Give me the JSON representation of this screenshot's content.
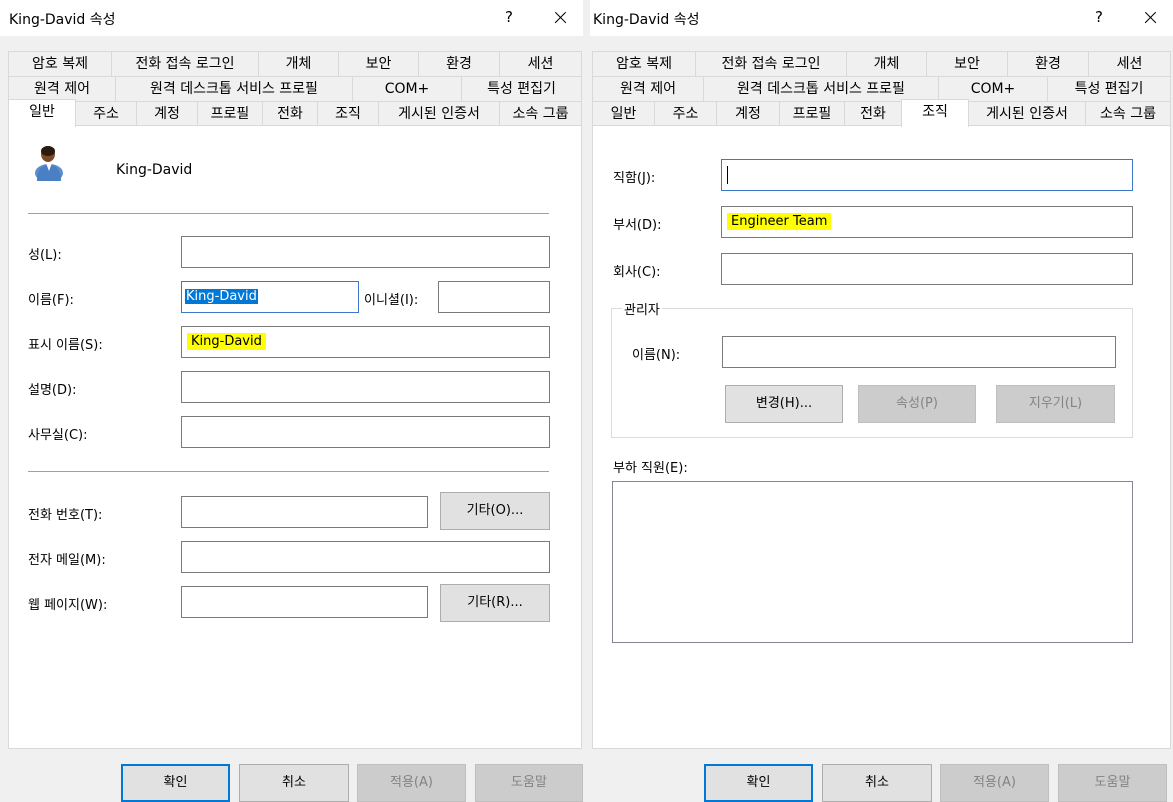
{
  "left": {
    "title": "King-David 속성",
    "help": "?",
    "tabs_row1": [
      "암호 복제",
      "전화 접속 로그인",
      "개체",
      "보안",
      "환경",
      "세션"
    ],
    "tabs_row2": [
      "원격 제어",
      "원격 데스크톱 서비스 프로필",
      "COM+",
      "특성 편집기"
    ],
    "tabs_row3": [
      "일반",
      "주소",
      "계정",
      "프로필",
      "전화",
      "조직",
      "게시된 인증서",
      "소속 그룹"
    ],
    "display_name_header": "King-David",
    "fields": {
      "last_name_label": "성(L):",
      "last_name_value": "",
      "first_name_label": "이름(F):",
      "first_name_value": "King-David",
      "initials_label": "이니셜(I):",
      "initials_value": "",
      "display_name_label": "표시 이름(S):",
      "display_name_value": "King-David",
      "description_label": "설명(D):",
      "description_value": "",
      "office_label": "사무실(C):",
      "office_value": "",
      "phone_label": "전화 번호(T):",
      "phone_value": "",
      "phone_other": "기타(O)...",
      "email_label": "전자 메일(M):",
      "email_value": "",
      "web_label": "웹 페이지(W):",
      "web_value": "",
      "web_other": "기타(R)..."
    },
    "buttons": {
      "ok": "확인",
      "cancel": "취소",
      "apply": "적용(A)",
      "help": "도움말"
    }
  },
  "right": {
    "title": "King-David 속성",
    "help": "?",
    "tabs_row1": [
      "암호 복제",
      "전화 접속 로그인",
      "개체",
      "보안",
      "환경",
      "세션"
    ],
    "tabs_row2": [
      "원격 제어",
      "원격 데스크톱 서비스 프로필",
      "COM+",
      "특성 편집기"
    ],
    "tabs_row3": [
      "일반",
      "주소",
      "계정",
      "프로필",
      "전화",
      "조직",
      "게시된 인증서",
      "소속 그룹"
    ],
    "fields": {
      "job_title_label": "직함(J):",
      "job_title_value": "",
      "department_label": "부서(D):",
      "department_value": "Engineer Team",
      "company_label": "회사(C):",
      "company_value": ""
    },
    "manager": {
      "group_title": "관리자",
      "name_label": "이름(N):",
      "name_value": "",
      "change": "변경(H)...",
      "properties": "속성(P)",
      "clear": "지우기(L)"
    },
    "direct_reports_label": "부하 직원(E):",
    "buttons": {
      "ok": "확인",
      "cancel": "취소",
      "apply": "적용(A)",
      "help": "도움말"
    }
  }
}
